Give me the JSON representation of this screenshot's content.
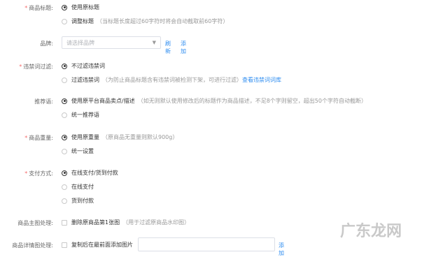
{
  "fields": {
    "title": {
      "required": "*",
      "label": "商品标题:",
      "option1": "使用原标题",
      "option2": "调整标题",
      "option2_hint": "（当标题长度超过60字符时将会自动截取前60字符）"
    },
    "brand": {
      "label": "品牌:",
      "placeholder": "请选择品牌",
      "refresh": "刷新",
      "add": "添加"
    },
    "banned": {
      "required": "*",
      "label": "违禁词过滤:",
      "option1": "不过滤违禁词",
      "option2": "过滤违禁词",
      "option2_hint": "（为防止商品标题含有违禁词被检测下架，可进行过滤）",
      "view_link": "查看违禁词词库"
    },
    "recommend": {
      "label": "推荐语:",
      "option1": "使用原平台商品卖点/描述",
      "option1_hint": "（如无则默认使用修改后的标题作为商品描述，不足8个字则留空，超出50个字符自动截断）",
      "option2": "统一推荐语"
    },
    "weight": {
      "required": "*",
      "label": "商品重量:",
      "option1": "使用原重量",
      "option1_hint": "（原商品无重量则默认900g）",
      "option2": "统一设置"
    },
    "payment": {
      "required": "*",
      "label": "支付方式:",
      "option1": "在线支付/货到付款",
      "option2": "在线支付",
      "option3": "货到付款"
    },
    "main_image": {
      "label": "商品主图处理:",
      "option": "删除原商品第1张图",
      "hint": "（用于过滤原商品水印图）"
    },
    "detail_image": {
      "label": "商品详情图处理:",
      "option": "复制后在最前面添加图片",
      "add": "添加"
    }
  },
  "watermark": "广东龙网",
  "colors": {
    "required": "#f56c6c",
    "link": "#2d8cf0",
    "hint": "#999999",
    "label": "#666666"
  }
}
